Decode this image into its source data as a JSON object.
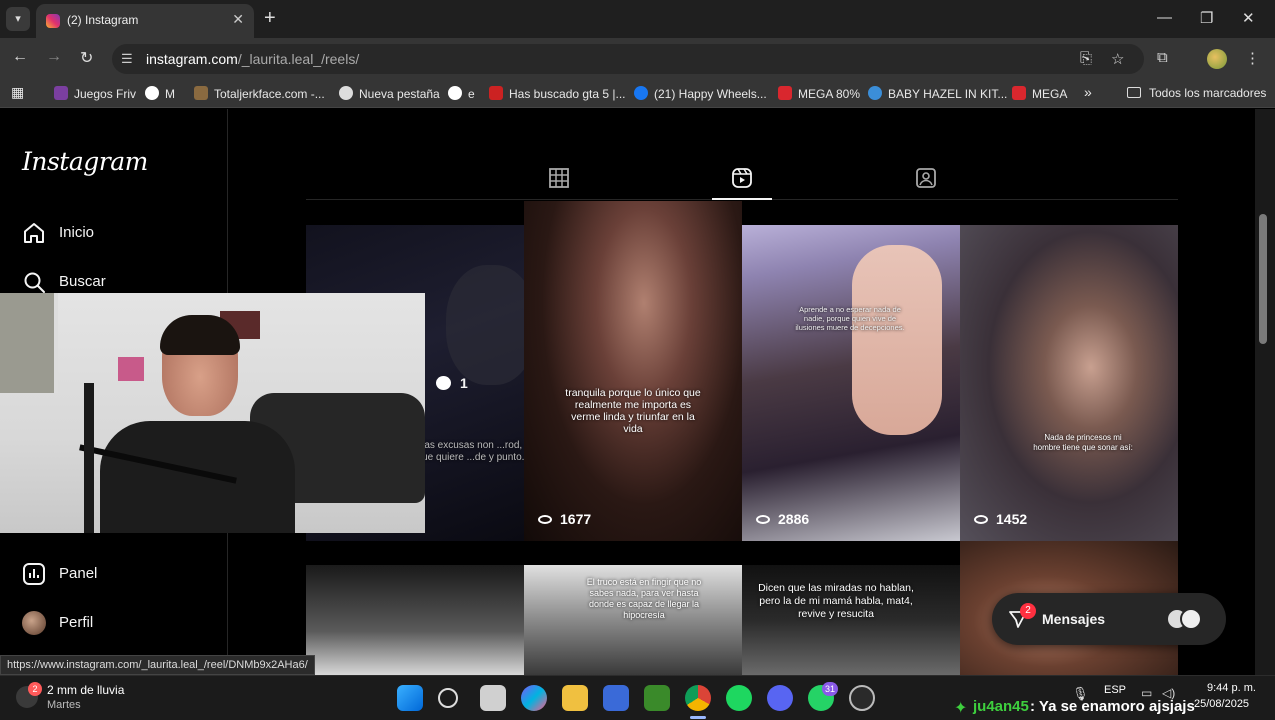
{
  "browser": {
    "tab_title": "(2) Instagram",
    "url_host": "instagram.com",
    "url_path": "/_laurita.leal_/reels/",
    "bookmarks": [
      {
        "label": "Juegos Friv",
        "color": "#7b3fa0"
      },
      {
        "label": "M",
        "color": "#4285f4"
      },
      {
        "label": "Totaljerkface.com -...",
        "color": "#8a6a40"
      },
      {
        "label": "Nueva pestaña",
        "color": "#555555"
      },
      {
        "label": "e",
        "color": "#4285f4"
      },
      {
        "label": "Has buscado gta 5 |...",
        "color": "#cc2222"
      },
      {
        "label": "(21) Happy Wheels...",
        "color": "#1877f2"
      },
      {
        "label": "MEGA 80%",
        "color": "#d9272e"
      },
      {
        "label": "BABY HAZEL IN KIT...",
        "color": "#3b8ed8"
      },
      {
        "label": "MEGA",
        "color": "#d9272e"
      }
    ],
    "bookmarks_overflow": "»",
    "all_bookmarks": "Todos los marcadores",
    "status_url": "https://www.instagram.com/_laurita.leal_/reel/DNMb9x2AHa6/"
  },
  "instagram": {
    "logo": "Instagram",
    "nav": [
      {
        "label": "Inicio",
        "icon": "home-icon"
      },
      {
        "label": "Buscar",
        "icon": "search-icon"
      },
      {
        "label": "Panel",
        "icon": "dashboard-icon"
      },
      {
        "label": "Perfil",
        "icon": "avatar"
      }
    ],
    "reels": [
      {
        "comments": "1",
        "caption": "...s las excusas non ...rod, el que quiere ...de y punto.",
        "views": ""
      },
      {
        "caption": "tranquila porque lo único que realmente me importa es verme linda y triunfar en la vida",
        "views": "1677"
      },
      {
        "caption": "Aprende a no esperar nada de nadie, porque quien vive de ilusiones muere de decepciones.",
        "views": "2886"
      },
      {
        "caption": "Nada de princesos mi hombre tiene que sonar así:",
        "views": "1452"
      },
      {
        "caption": "",
        "views": ""
      },
      {
        "caption": "El truco está en fingir que no sabes nada, para ver hasta donde es capaz de llegar la hipocresía",
        "views": ""
      },
      {
        "caption": "Dicen que las miradas no hablan, pero la de mi mamá habla, mat4, revive y resucita",
        "views": ""
      },
      {
        "caption": "",
        "views": ""
      }
    ],
    "messages_label": "Mensajes",
    "messages_badge": "2"
  },
  "taskbar": {
    "weather_badge": "2",
    "weather_line1": "2 mm de lluvia",
    "weather_line2": "Martes",
    "whatsapp_badge": "31",
    "chat_user": "ju4an45",
    "chat_text": ": Ya se enamoro ajsjajs",
    "language": "ESP",
    "time": "9:44 p. m.",
    "date": "25/08/2025"
  },
  "colors": {
    "accent": "#0095f6",
    "badge": "#ff3040",
    "twitch_user": "#3ecf3e"
  }
}
